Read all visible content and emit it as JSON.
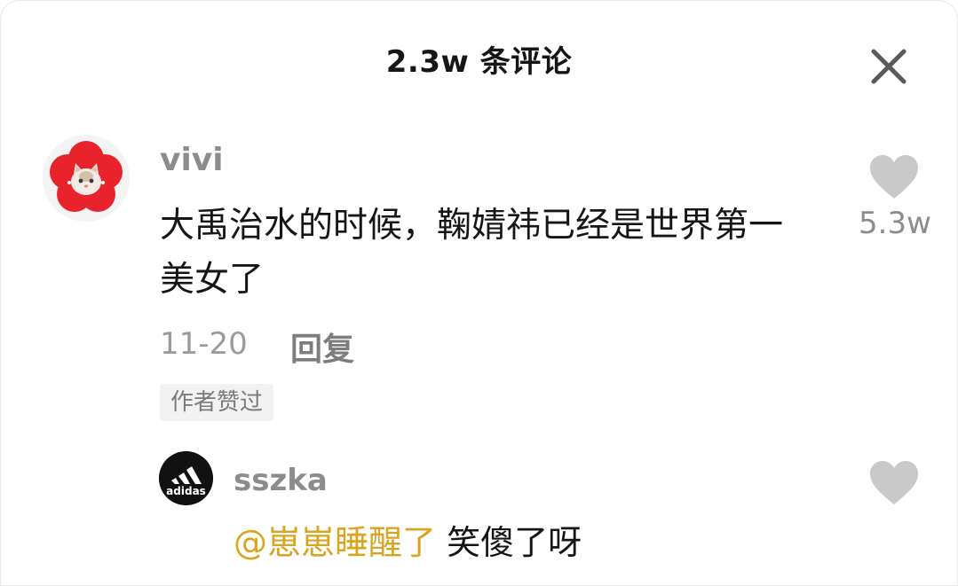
{
  "header": {
    "title": "2.3w 条评论",
    "close_icon": "close-icon"
  },
  "comments": [
    {
      "username": "vivi",
      "avatar_icon": "cat-flower-avatar",
      "text": "大禹治水的时候，鞠婧祎已经是世界第一美女了",
      "date": "11-20",
      "reply_label": "回复",
      "badge": "作者赞过",
      "like_count": "5.3w",
      "like_icon": "heart-icon"
    }
  ],
  "replies": [
    {
      "username": "sszka",
      "avatar_icon": "adidas-logo-avatar",
      "avatar_text": "adidas",
      "mention": "@崽崽睡醒了",
      "text": "笑傻了呀",
      "like_icon": "heart-icon"
    }
  ],
  "colors": {
    "text_primary": "#161616",
    "text_secondary": "#8c8c8c",
    "heart": "#c9c9c9",
    "mention": "#d9a520",
    "avatar_red": "#e8232b"
  }
}
